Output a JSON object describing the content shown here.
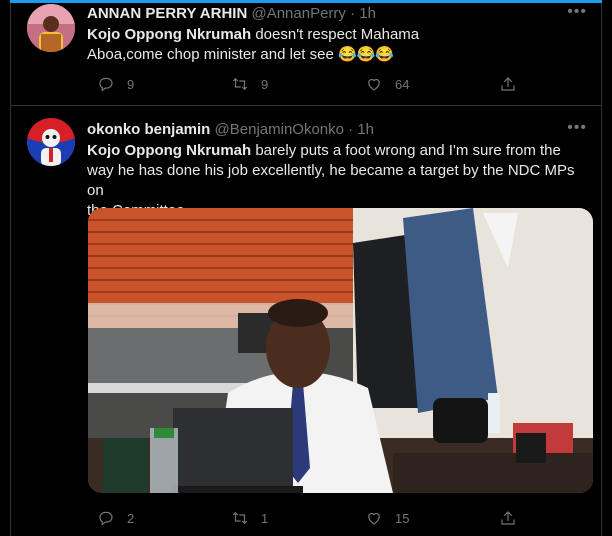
{
  "tweets": [
    {
      "name": "ANNAN PERRY ARHIN",
      "handle": "@AnnanPerry",
      "time": "· 1h",
      "mention": "Kojo Oppong Nkrumah",
      "text_rest": " doesn't respect Mahama",
      "text_line2": "Aboa,come chop minister and let see 😂😂😂",
      "replies": "9",
      "retweets": "9",
      "likes": "64"
    },
    {
      "name": "okonko benjamin",
      "handle": "@BenjaminOkonko",
      "time": "· 1h",
      "mention": "Kojo Oppong Nkrumah",
      "text_rest": " barely puts a foot wrong and I'm sure from the",
      "text_line2": "way he has done his job excellently, he became a target by the NDC MPs on",
      "text_line3": "the Committee.",
      "replies": "2",
      "retweets": "1",
      "likes": "15"
    }
  ],
  "icons": {
    "more": "more-icon",
    "reply": "reply-icon",
    "retweet": "retweet-icon",
    "like": "heart-icon",
    "share": "share-icon"
  },
  "colors": {
    "background": "#000000",
    "accent": "#1d9bf0",
    "muted": "#71767b",
    "text": "#e7e9ea"
  }
}
